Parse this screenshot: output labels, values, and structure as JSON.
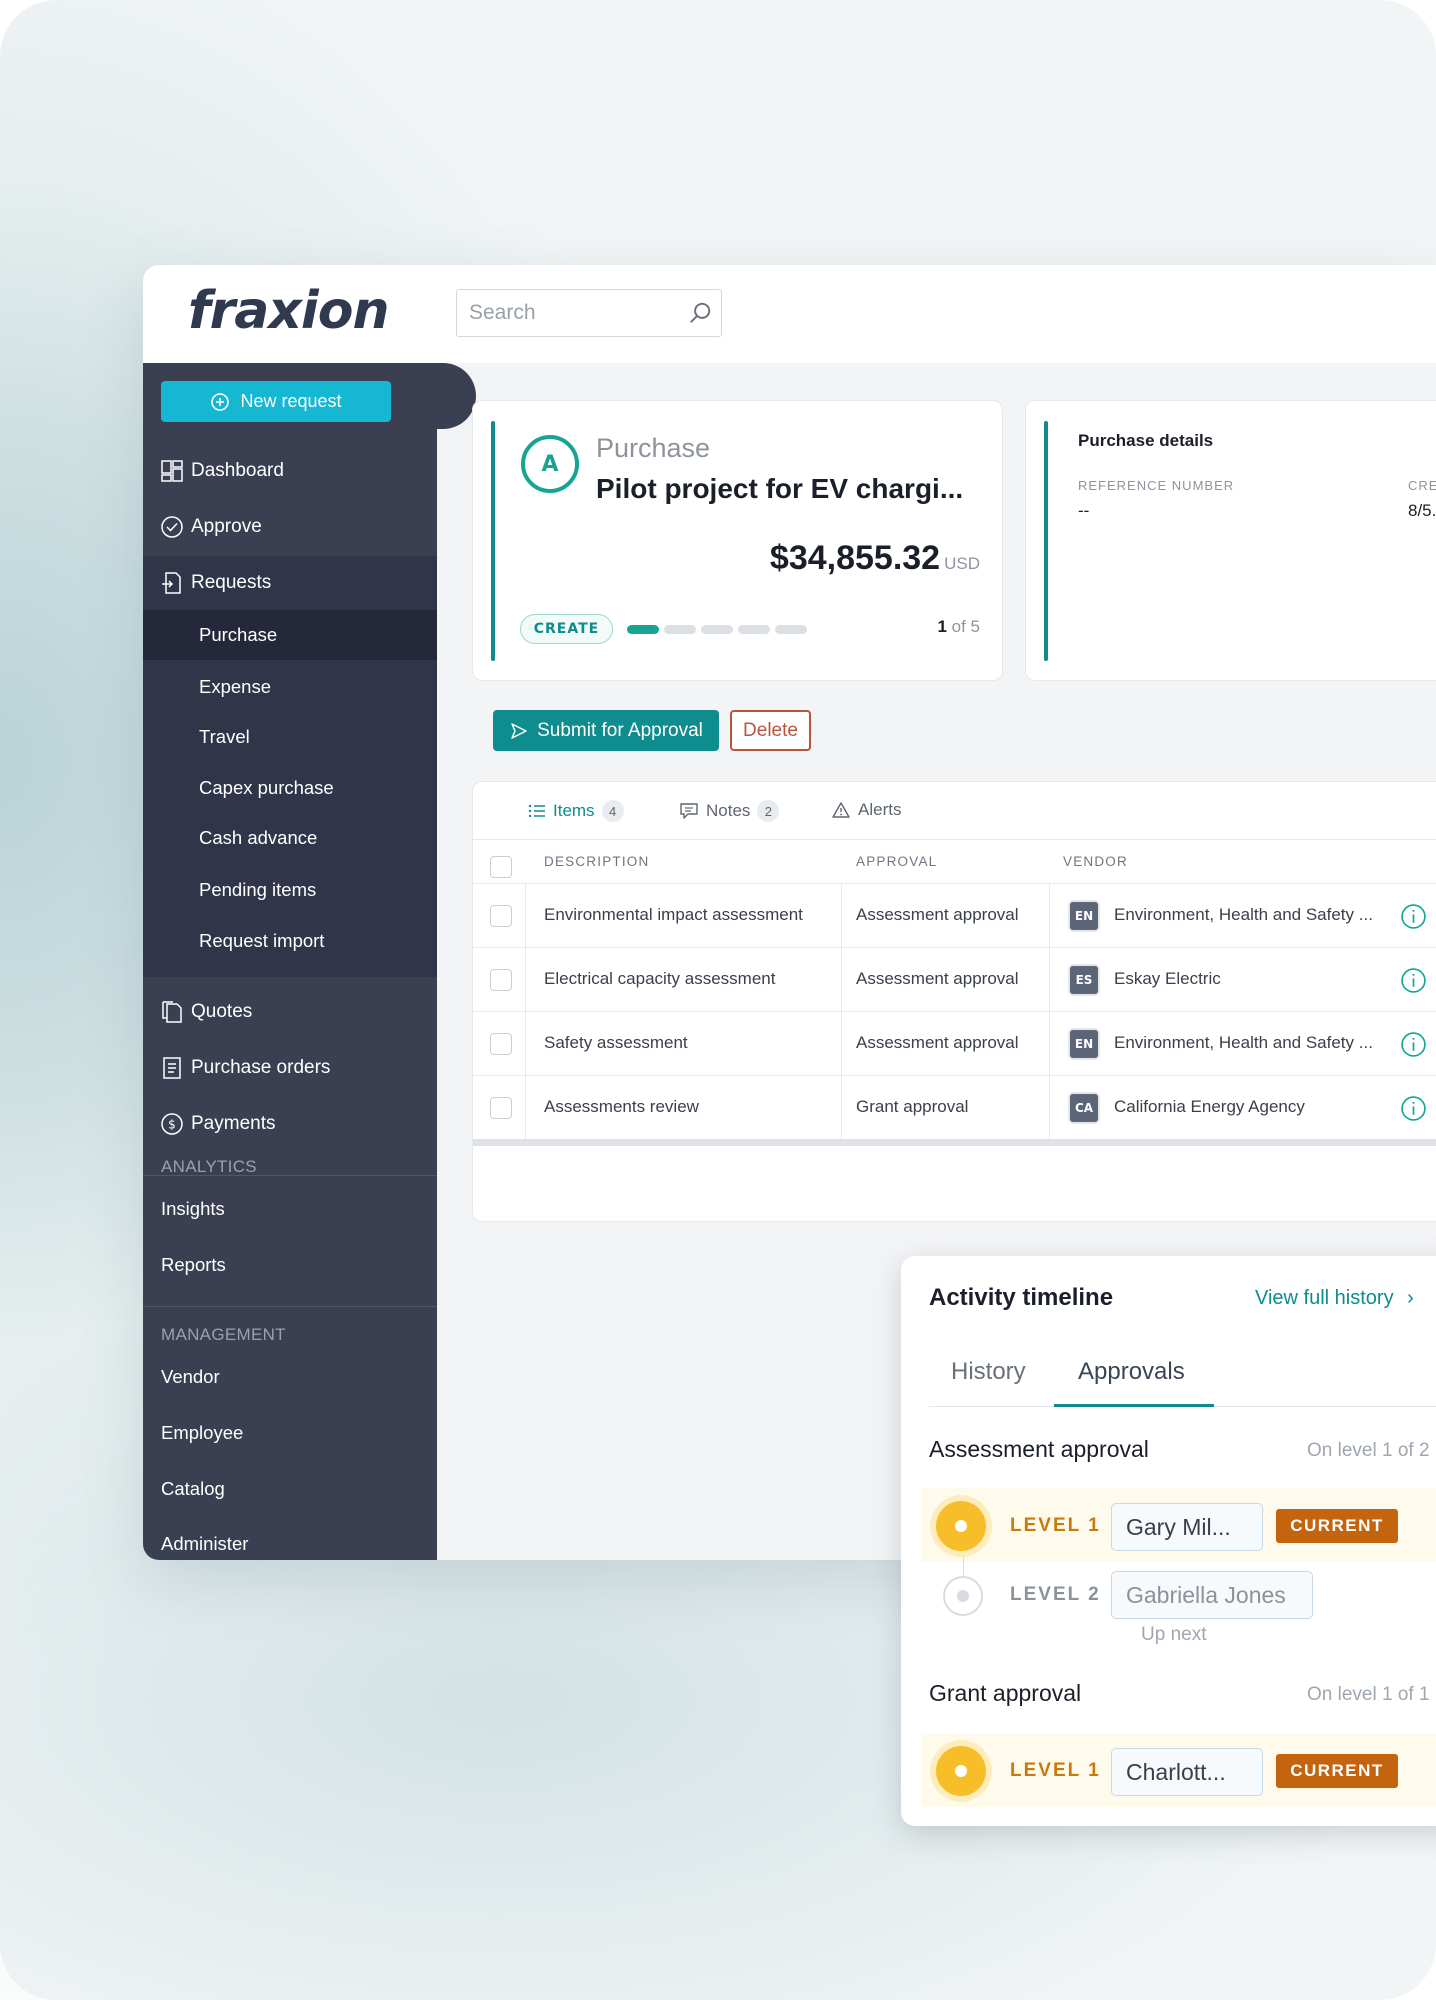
{
  "app": {
    "logo": "fraxion",
    "search": {
      "placeholder": "Search"
    }
  },
  "sidebar": {
    "new_request": "New request",
    "items": [
      {
        "label": "Dashboard",
        "icon": "dashboard-icon"
      },
      {
        "label": "Approve",
        "icon": "check-circle-icon"
      },
      {
        "label": "Requests",
        "icon": "requests-icon"
      },
      {
        "label": "Quotes",
        "icon": "quotes-icon"
      },
      {
        "label": "Purchase orders",
        "icon": "purchase-orders-icon"
      },
      {
        "label": "Payments",
        "icon": "dollar-circle-icon"
      }
    ],
    "request_subitems": [
      "Purchase",
      "Expense",
      "Travel",
      "Capex purchase",
      "Cash advance",
      "Pending items",
      "Request import"
    ],
    "analytics_label": "ANALYTICS",
    "analytics_items": [
      "Insights",
      "Reports"
    ],
    "management_label": "MANAGEMENT",
    "management_items": [
      "Vendor",
      "Employee",
      "Catalog",
      "Administer"
    ]
  },
  "request": {
    "avatar_letter": "A",
    "type": "Purchase",
    "title": "Pilot project for EV chargi...",
    "amount": "$34,855.32",
    "currency": "USD",
    "status": "CREATE",
    "step_current": "1",
    "step_of": "of 5",
    "progress_fraction": 0.2
  },
  "purchase_details": {
    "title": "Purchase details",
    "reference_label": "REFERENCE NUMBER",
    "reference_value": "--",
    "created_label": "CRE",
    "created_value": "8/5."
  },
  "actions": {
    "submit": "Submit for Approval",
    "delete": "Delete"
  },
  "items_table": {
    "tabs": [
      {
        "label": "Items",
        "count": "4"
      },
      {
        "label": "Notes",
        "count": "2"
      },
      {
        "label": "Alerts"
      }
    ],
    "headers": [
      "DESCRIPTION",
      "APPROVAL",
      "VENDOR"
    ],
    "rows": [
      {
        "description": "Environmental impact assessment",
        "approval": "Assessment approval",
        "vendor_code": "EN",
        "vendor": "Environment, Health and Safety ..."
      },
      {
        "description": "Electrical capacity assessment",
        "approval": "Assessment approval",
        "vendor_code": "ES",
        "vendor": "Eskay Electric"
      },
      {
        "description": "Safety assessment",
        "approval": "Assessment approval",
        "vendor_code": "EN",
        "vendor": "Environment, Health and Safety ..."
      },
      {
        "description": "Assessments review",
        "approval": "Grant approval",
        "vendor_code": "CA",
        "vendor": "California Energy Agency"
      }
    ]
  },
  "timeline": {
    "title": "Activity timeline",
    "view_full": "View full history",
    "tabs": [
      "History",
      "Approvals"
    ],
    "assessment": {
      "title": "Assessment approval",
      "on_level": "On level 1 of 2",
      "level1_label": "LEVEL 1",
      "level1_person": "Gary Mil...",
      "level1_status": "CURRENT",
      "level2_label": "LEVEL 2",
      "level2_person": "Gabriella Jones",
      "level2_note": "Up next"
    },
    "grant": {
      "title": "Grant approval",
      "on_level": "On level 1 of 1",
      "level1_label": "LEVEL 1",
      "level1_person": "Charlott...",
      "level1_status": "CURRENT"
    }
  },
  "colors": {
    "accent_teal": "#0e8c8e",
    "cyan_button": "#16b7d3",
    "sidebar_bg": "#3a3f52",
    "current_badge": "#c5640e",
    "delete_border": "#b9553c"
  }
}
